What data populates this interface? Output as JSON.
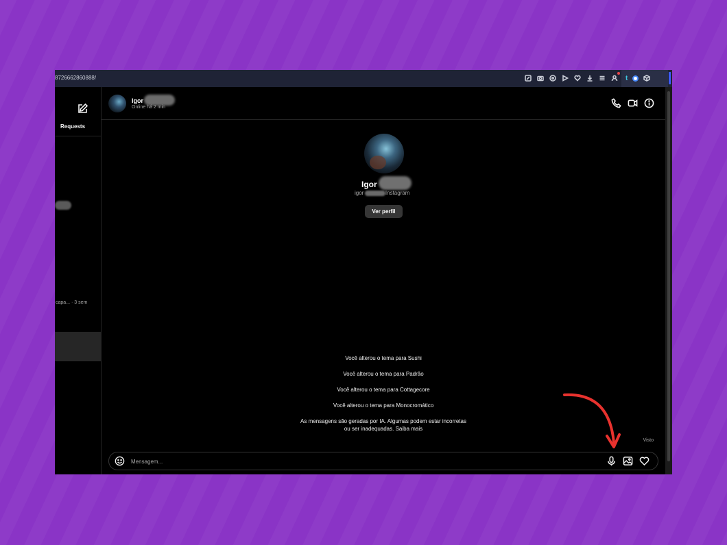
{
  "browser": {
    "url": "8726662860888/"
  },
  "sidebar": {
    "requests_label": "Requests",
    "conversation_preview": "capa... · 3 sem"
  },
  "chat": {
    "header": {
      "name": "Igor",
      "status": "Online há 2 min"
    },
    "profile": {
      "name": "Igor",
      "subtitle": "igor            · Instagram",
      "view_profile_button": "Ver perfil"
    },
    "system_messages": [
      "Você alterou o tema para Sushi",
      "Você alterou o tema para Padrão",
      "Você alterou o tema para Cottagecore",
      "Você alterou o tema para Monocromático"
    ],
    "ai_notice_line1": "As mensagens são geradas por IA. Algumas podem estar incorretas",
    "ai_notice_line2": "ou ser inadequadas. Saiba mais",
    "seen_label": "Visto",
    "composer": {
      "placeholder": "Mensagem..."
    }
  },
  "colors": {
    "background": "#8a34c6",
    "chat_bg": "#000000",
    "annotation_arrow": "#e8322e",
    "button_bg": "#363636"
  },
  "icons": {
    "header_actions": [
      "phone-icon",
      "video-icon",
      "info-icon"
    ],
    "composer_actions": [
      "microphone-icon",
      "image-icon",
      "heart-icon"
    ]
  }
}
